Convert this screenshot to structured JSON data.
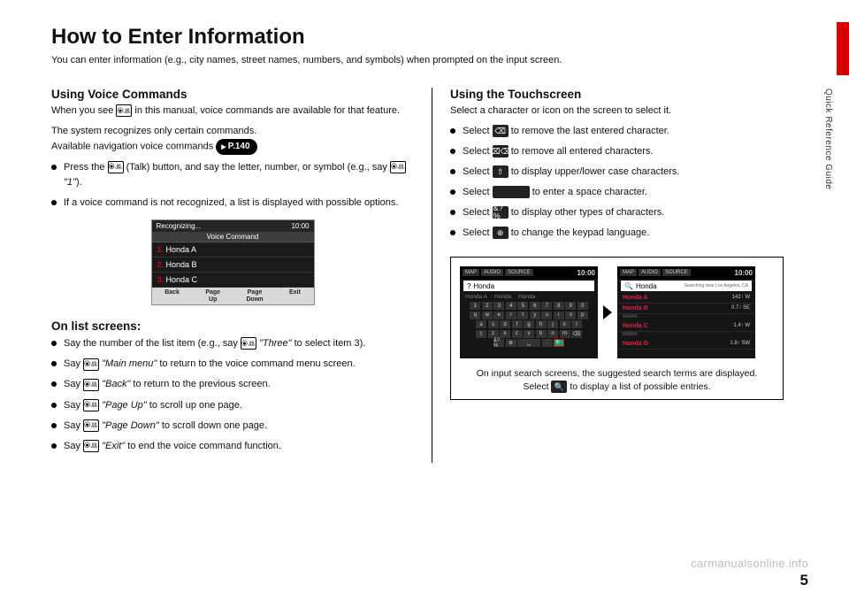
{
  "side_label": "Quick Reference Guide",
  "title": "How to Enter Information",
  "intro": "You can enter information (e.g., city names, street names, numbers, and symbols) when prompted on the input screen.",
  "left": {
    "h_voice": "Using Voice Commands",
    "p1a": "When you see ",
    "p1b": " in this manual, voice commands are available for that feature.",
    "p2": "The system recognizes only certain commands.",
    "p3": "Available navigation voice commands ",
    "pill": "P.140",
    "b1a": "Press the ",
    "b1b": " (Talk) button, and say the letter, number, or symbol (e.g., say ",
    "b1c": "\"1\"",
    "b1d": ").",
    "b2": "If a voice command is not recognized, a list is displayed with possible options.",
    "vc": {
      "top_left": "Recognizing...",
      "time": "10:00",
      "bar": "Voice Command",
      "items": [
        "Honda A",
        "Honda B",
        "Honda C"
      ],
      "bottom": [
        "Back",
        "Page\nUp",
        "Page\nDown",
        "Exit"
      ]
    },
    "h_list": "On list screens:",
    "l1a": "Say the number of the list item (e.g., say ",
    "l1b": "\"Three\"",
    "l1c": " to select item 3).",
    "l2a": "Say ",
    "l2b": "\"Main menu\"",
    "l2c": " to return to the voice command menu screen.",
    "l3a": "Say ",
    "l3b": "\"Back\"",
    "l3c": " to return to the previous screen.",
    "l4a": "Say ",
    "l4b": "\"Page Up\"",
    "l4c": " to scroll up one page.",
    "l5a": "Say ",
    "l5b": "\"Page Down\"",
    "l5c": " to scroll down one page.",
    "l6a": "Say ",
    "l6b": "\"Exit\"",
    "l6c": " to end the voice command function."
  },
  "right": {
    "h_touch": "Using the Touchscreen",
    "p1": "Select a character or icon on the screen to select it.",
    "t1a": "Select ",
    "t1b": " to remove the last entered character.",
    "t2a": "Select ",
    "t2b": " to remove all entered characters.",
    "t3a": "Select ",
    "t3b": " to display upper/lower case characters.",
    "t4a": "Select ",
    "t4b": " to enter a space character.",
    "t5a": "Select ",
    "t5b": " to display other types of characters.",
    "t6a": "Select ",
    "t6b": " to change the keypad language.",
    "screens": {
      "tabs": [
        "MAP",
        "AUDIO",
        "SOURCE"
      ],
      "time": "10:00",
      "search_text": "Honda",
      "suggest": [
        "Honda A",
        "Honda",
        "Honda"
      ],
      "searching": "Searching near Los Angeles, CA",
      "results": [
        {
          "name": "Honda A",
          "sub": "",
          "dist": "142↑  W"
        },
        {
          "name": "Honda B",
          "sub": "AAAAA",
          "dist": "0.7↑  SE"
        },
        {
          "name": "Honda C",
          "sub": "BBBBB",
          "dist": "1.4↑  W"
        },
        {
          "name": "Honda D",
          "sub": "",
          "dist": "1.8↑  SW"
        }
      ]
    },
    "caption_a": "On input search screens, the suggested search terms are displayed. Select ",
    "caption_b": " to display a list of possible entries."
  },
  "page_number": "5",
  "watermark": "carmanualsonline.info",
  "icons": {
    "talk": "⦿ꔛ",
    "backspace": "⌫",
    "clear_all": "⌫⌫",
    "shift": "⇧",
    "space": " ",
    "symbols": "&?%",
    "globe": "⊕",
    "search": "🔍"
  }
}
